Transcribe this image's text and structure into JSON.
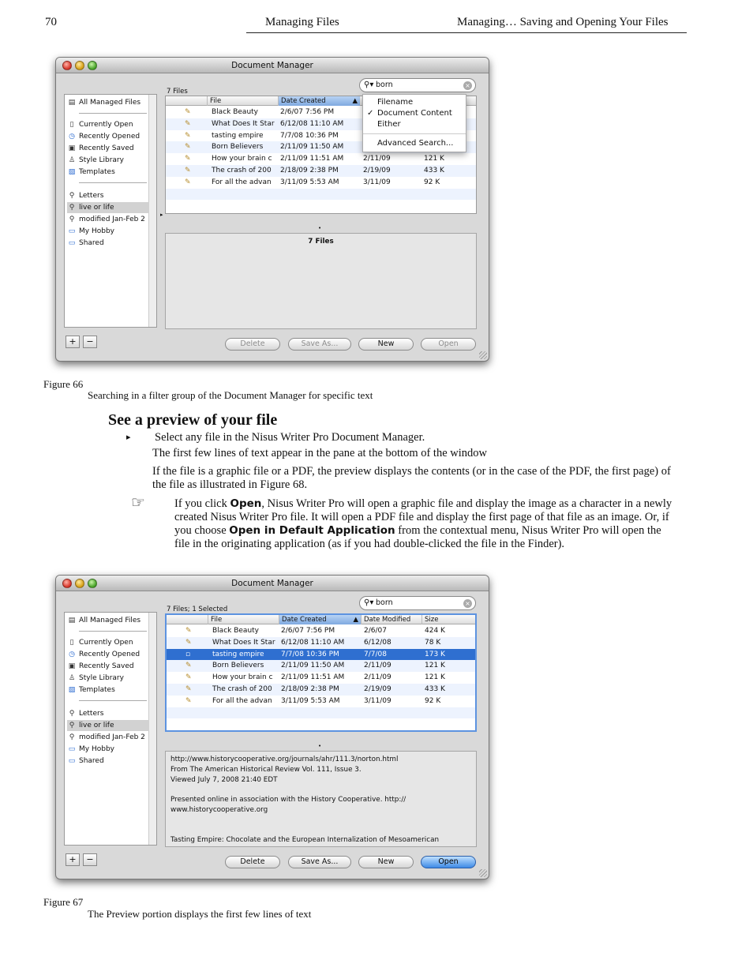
{
  "header": {
    "page_number": "70",
    "section": "Managing Files",
    "chapter": "Managing… Saving and Opening Your Files"
  },
  "figure66": {
    "window": {
      "title": "Document Manager",
      "count": "7 Files",
      "search_value": "born",
      "sidebar": [
        {
          "label": "All Managed Files",
          "icon": "drawer-icon"
        },
        {
          "label": "Currently Open",
          "icon": "document-icon"
        },
        {
          "label": "Recently Opened",
          "icon": "clock-icon"
        },
        {
          "label": "Recently Saved",
          "icon": "disk-icon"
        },
        {
          "label": "Style Library",
          "icon": "style-icon"
        },
        {
          "label": "Templates",
          "icon": "template-icon"
        },
        {
          "label": "Letters",
          "icon": "search-folder-icon"
        },
        {
          "label": "live or life",
          "icon": "search-folder-icon"
        },
        {
          "label": "modified Jan-Feb 2",
          "icon": "search-folder-icon"
        },
        {
          "label": "My Hobby",
          "icon": "folder-icon"
        },
        {
          "label": "Shared",
          "icon": "folder-icon"
        }
      ],
      "columns": [
        "File",
        "Date Created"
      ],
      "rows": [
        {
          "file": "Black Beauty",
          "created": "2/6/07 7:56 PM",
          "modified": "",
          "size": ""
        },
        {
          "file": "What Does It Star",
          "created": "6/12/08 11:10 AM",
          "modified": "",
          "size": ""
        },
        {
          "file": "tasting empire",
          "created": "7/7/08 10:36 PM",
          "modified": "",
          "size": ""
        },
        {
          "file": "Born Believers",
          "created": "2/11/09 11:50 AM",
          "modified": "",
          "size": ""
        },
        {
          "file": "How your brain c",
          "created": "2/11/09 11:51 AM",
          "modified": "2/11/09",
          "size": "121 K"
        },
        {
          "file": "The crash of 200",
          "created": "2/18/09 2:38 PM",
          "modified": "2/19/09",
          "size": "433 K"
        },
        {
          "file": "For all the advan",
          "created": "3/11/09 5:53 AM",
          "modified": "3/11/09",
          "size": "92 K"
        }
      ],
      "preview_title": "7 Files",
      "menu": {
        "items": [
          "Filename",
          "Document Content",
          "Either",
          "Advanced Search..."
        ],
        "checked": "Document Content"
      },
      "buttons": {
        "plus": "+",
        "minus": "−",
        "delete": "Delete",
        "save_as": "Save As...",
        "new": "New",
        "open": "Open"
      }
    },
    "caption_label": "Figure 66",
    "caption_text": "Searching in a filter group of the Document Manager for specific text"
  },
  "section": {
    "heading": "See a preview of your file",
    "bullet_marker": "▸",
    "bullet": "Select any file in the Nisus Writer Pro Document Manager.",
    "p1": "The first few lines of text appear in the pane at the bottom of the window",
    "p2": "If the file is a graphic file or a PDF, the preview displays the contents (or in the case of the PDF, the first page) of the file as illustrated in Figure 68.",
    "note_icon": "☞",
    "note_a": "If you click ",
    "note_open": "Open",
    "note_b": ", Nisus Writer Pro will open a graphic file and display the image as a character in a newly created Nisus Writer Pro file. It will open a PDF file and display the first page of that file as an image. Or, if you choose ",
    "note_default": "Open in Default Application",
    "note_c": " from the contextual menu, Nisus Writer Pro will open the file in the originating application (as if you had double-clicked the file in the Finder)."
  },
  "figure67": {
    "window": {
      "title": "Document Manager",
      "count": "7 Files; 1 Selected",
      "search_value": "born",
      "columns": [
        "File",
        "Date Created",
        "Date Modified",
        "Size"
      ],
      "rows": [
        {
          "file": "Black Beauty",
          "created": "2/6/07 7:56 PM",
          "modified": "2/6/07",
          "size": "424 K"
        },
        {
          "file": "What Does It Star",
          "created": "6/12/08 11:10 AM",
          "modified": "6/12/08",
          "size": "78 K"
        },
        {
          "file": "tasting empire",
          "created": "7/7/08 10:36 PM",
          "modified": "7/7/08",
          "size": "173 K"
        },
        {
          "file": "Born Believers",
          "created": "2/11/09 11:50 AM",
          "modified": "2/11/09",
          "size": "121 K"
        },
        {
          "file": "How your brain c",
          "created": "2/11/09 11:51 AM",
          "modified": "2/11/09",
          "size": "121 K"
        },
        {
          "file": "The crash of 200",
          "created": "2/18/09 2:38 PM",
          "modified": "2/19/09",
          "size": "433 K"
        },
        {
          "file": "For all the advan",
          "created": "3/11/09 5:53 AM",
          "modified": "3/11/09",
          "size": "92 K"
        }
      ],
      "selected_index": 2,
      "preview_lines": [
        "http://www.historycooperative.org/journals/ahr/111.3/norton.html",
        "From The American Historical Review Vol. 111, Issue 3.",
        "Viewed July 7, 2008 21:40 EDT",
        "",
        "Presented online in association with the History Cooperative. http://",
        "www.historycooperative.org",
        "",
        "",
        "Tasting Empire: Chocolate and the European Internalization of Mesoamerican"
      ]
    },
    "caption_label": "Figure 67",
    "caption_text": "The Preview portion displays the first few lines of text"
  }
}
